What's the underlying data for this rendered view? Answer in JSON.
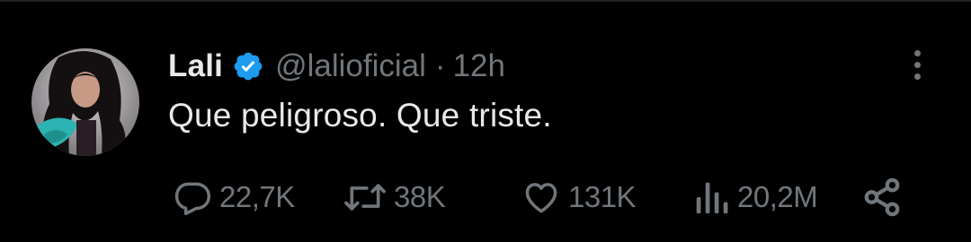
{
  "tweet": {
    "author_name": "Lali",
    "handle": "@lalioficial",
    "separator": "·",
    "time": "12h",
    "text": "Que peligroso. Que triste.",
    "verified_icon": "verified-badge-icon",
    "more_icon": "more-vertical-icon"
  },
  "actions": {
    "replies": {
      "icon": "reply-icon",
      "count": "22,7K"
    },
    "reposts": {
      "icon": "repost-icon",
      "count": "38K"
    },
    "likes": {
      "icon": "heart-icon",
      "count": "131K"
    },
    "views": {
      "icon": "views-icon",
      "count": "20,2M"
    },
    "share": {
      "icon": "share-icon"
    }
  },
  "colors": {
    "background": "#000000",
    "primary_text": "#e7e9ea",
    "secondary_text": "#71767b",
    "verified_blue": "#1d9bf0"
  }
}
